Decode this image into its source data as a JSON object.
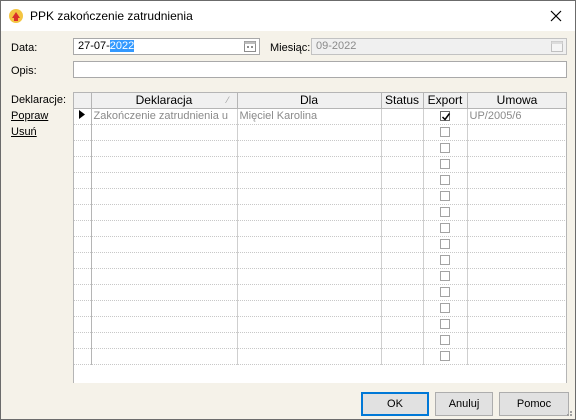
{
  "window": {
    "title": "PPK zakończenie zatrudnienia"
  },
  "form": {
    "data_label": "Data:",
    "data_value_prefix": "27-07-",
    "data_value_selected": "2022",
    "miesiac_label": "Miesiąc:",
    "miesiac_value": "09-2022",
    "opis_label": "Opis:",
    "opis_value": "",
    "deklaracje_label": "Deklaracje:"
  },
  "side_links": {
    "popraw": "Popraw",
    "usun": "Usuń"
  },
  "grid": {
    "columns": [
      "Deklaracja",
      "Dla",
      "Status",
      "Export",
      "Umowa"
    ],
    "rows": [
      {
        "current": true,
        "deklaracja": "Zakończenie zatrudnienia u",
        "dla": "Mięciel Karolina",
        "status": "",
        "export": true,
        "umowa": "UP/2005/6"
      }
    ],
    "empty_row_count": 15
  },
  "buttons": {
    "ok": "OK",
    "anuluj": "Anuluj",
    "pomoc": "Pomoc"
  },
  "colors": {
    "selection": "#3399ff",
    "dialog_bg": "#f5f2e9",
    "accent": "#0078d7"
  }
}
